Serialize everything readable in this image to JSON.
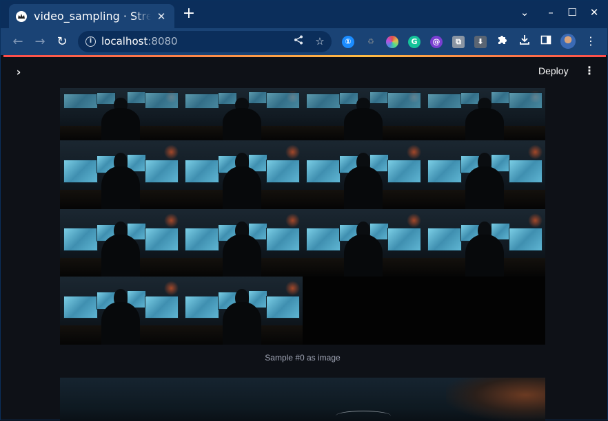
{
  "browser": {
    "tab_title": "video_sampling · Streamlit",
    "tab_close": "✕",
    "new_tab": "+",
    "window_controls": {
      "chevron": "⌄",
      "minimize": "–",
      "maximize": "☐",
      "close": "✕"
    },
    "url_host": "localhost",
    "url_port": ":8080",
    "extensions": [
      {
        "name": "1password-icon",
        "glyph": "①",
        "color": "#1a8cff"
      },
      {
        "name": "recycle-icon",
        "glyph": "♻",
        "color": "#6b7a8a"
      },
      {
        "name": "color-wheel-icon",
        "glyph": "✿",
        "color": "#e04e9a"
      },
      {
        "name": "grammarly-icon",
        "glyph": "G",
        "color": "#15c39a"
      },
      {
        "name": "purple-extension-icon",
        "glyph": "@",
        "color": "#7a3fd1"
      },
      {
        "name": "tab-extension-icon",
        "glyph": "⧉",
        "color": "#8a95a3"
      },
      {
        "name": "download-extension-icon",
        "glyph": "⬇",
        "color": "#5a6573"
      }
    ]
  },
  "app": {
    "deploy_label": "Deploy",
    "sidebar_toggle": "›",
    "main_menu": "⋮",
    "image_caption": "Sample #0 as image"
  },
  "grid": {
    "columns": 4,
    "rows": 4,
    "frame_count": 14
  }
}
